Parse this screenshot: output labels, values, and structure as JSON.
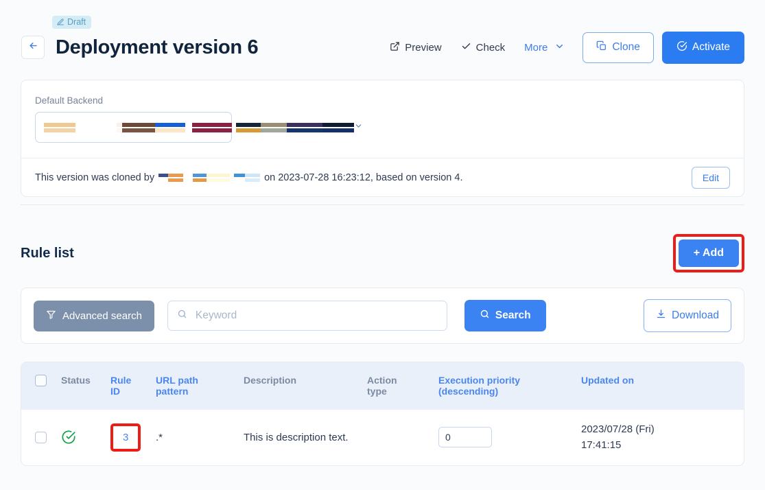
{
  "header": {
    "badge": {
      "label": "Draft",
      "icon": "pencil-icon",
      "bg": "#d4ecf5",
      "fg": "#5b9dc4"
    },
    "back_icon": "arrow-left-icon",
    "title": "Deployment version 6",
    "actions": {
      "preview": "Preview",
      "check": "Check",
      "more": "More",
      "clone": "Clone",
      "activate": "Activate"
    }
  },
  "backend_card": {
    "label": "Default Backend",
    "selected_value": "",
    "chevron_icon": "chevron-down-icon",
    "clone_info_prefix": "This version was cloned by",
    "clone_info_suffix": "on 2023-07-28 16:23:12, based on version 4.",
    "edit_label": "Edit"
  },
  "rule_list": {
    "title": "Rule list",
    "add_label": "+ Add",
    "add_highlight_color": "#ee1c16"
  },
  "search": {
    "advanced_label": "Advanced search",
    "advanced_icon": "filter-icon",
    "keyword_value": "",
    "keyword_placeholder": "Keyword",
    "search_label": "Search",
    "search_icon": "search-icon",
    "download_label": "Download",
    "download_icon": "download-icon"
  },
  "table": {
    "columns": [
      {
        "label": "Status",
        "line2": "",
        "sortable": false
      },
      {
        "label": "Rule",
        "line2": "ID",
        "sortable": true
      },
      {
        "label": "URL path",
        "line2": "pattern",
        "sortable": true
      },
      {
        "label": "Description",
        "line2": "",
        "sortable": false
      },
      {
        "label": "Action",
        "line2": "type",
        "sortable": false
      },
      {
        "label": "Execution priority",
        "line2": "(descending)",
        "sortable": true
      },
      {
        "label": "Updated on",
        "line2": "",
        "sortable": true
      }
    ],
    "rows": [
      {
        "status_icon": "check-circle-icon",
        "status_color": "#16a34a",
        "rule_id": "3",
        "rule_id_highlighted": true,
        "url_pattern": ".*",
        "description": "This is description text.",
        "action_type": "",
        "priority": "0",
        "updated_date": "2023/07/28 (Fri)",
        "updated_time": "17:41:15"
      }
    ]
  },
  "redactions": {
    "select_row1": [
      {
        "w": 46,
        "c": "#f0c891"
      },
      {
        "w": 60,
        "c": "#ffffff"
      },
      {
        "w": 8,
        "c": "#f7f3ea"
      },
      {
        "w": 48,
        "c": "#6b4a38"
      },
      {
        "w": 44,
        "c": "#1560d8"
      },
      {
        "w": 10,
        "c": "#ffffff"
      },
      {
        "w": 58,
        "c": "#8a2140"
      },
      {
        "w": 6,
        "c": "#ffffff"
      },
      {
        "w": 36,
        "c": "#16243c"
      },
      {
        "w": 38,
        "c": "#9a8f72"
      },
      {
        "w": 52,
        "c": "#3a3060"
      },
      {
        "w": 46,
        "c": "#101c33"
      }
    ],
    "select_row2": [
      {
        "w": 46,
        "c": "#f3d3a4"
      },
      {
        "w": 60,
        "c": "#ffffff"
      },
      {
        "w": 8,
        "c": "#faf8f2"
      },
      {
        "w": 48,
        "c": "#7a5440"
      },
      {
        "w": 44,
        "c": "#fbe7c6"
      },
      {
        "w": 10,
        "c": "#ffffff"
      },
      {
        "w": 58,
        "c": "#8a2140"
      },
      {
        "w": 6,
        "c": "#ffffff"
      },
      {
        "w": 36,
        "c": "#d89a36"
      },
      {
        "w": 38,
        "c": "#9fa79b"
      },
      {
        "w": 52,
        "c": "#16356e"
      },
      {
        "w": 46,
        "c": "#14306a"
      }
    ],
    "clone_row1": [
      {
        "w": 14,
        "c": "#3a4f8f"
      },
      {
        "w": 22,
        "c": "#e89b4f"
      },
      {
        "w": 14,
        "c": "#ffffff"
      },
      {
        "w": 20,
        "c": "#4f96d8"
      },
      {
        "w": 34,
        "c": "#fbf6cf"
      },
      {
        "w": 6,
        "c": "#ffffff"
      },
      {
        "w": 16,
        "c": "#3f92d6"
      },
      {
        "w": 22,
        "c": "#cfe6f7"
      }
    ],
    "clone_row2": [
      {
        "w": 14,
        "c": "#ffffff"
      },
      {
        "w": 22,
        "c": "#e89b4f"
      },
      {
        "w": 14,
        "c": "#ffffff"
      },
      {
        "w": 20,
        "c": "#e09a4a"
      },
      {
        "w": 34,
        "c": "#fdfae0"
      },
      {
        "w": 6,
        "c": "#ffffff"
      },
      {
        "w": 16,
        "c": "#ffffff"
      },
      {
        "w": 22,
        "c": "#d8ecfa"
      }
    ]
  }
}
